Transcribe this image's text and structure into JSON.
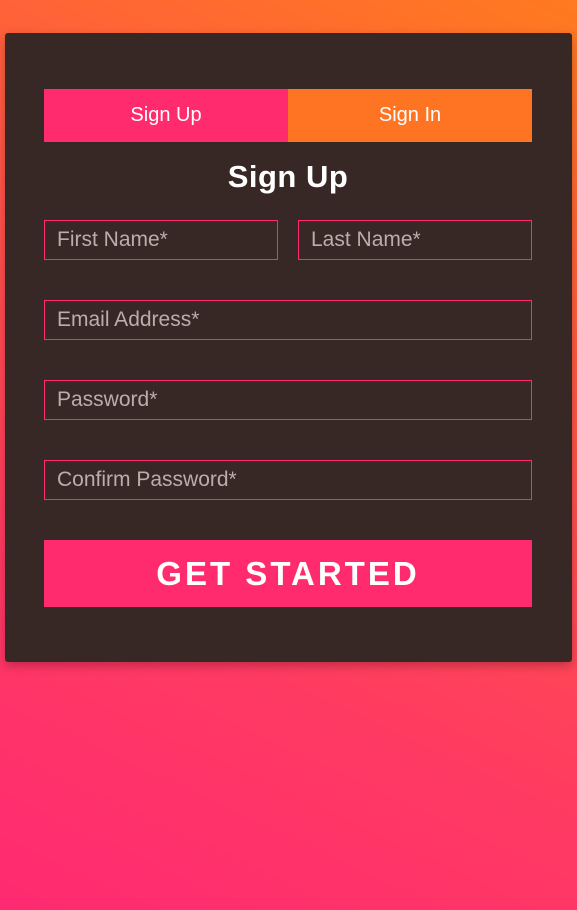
{
  "tabs": [
    {
      "label": "Sign Up",
      "active": true
    },
    {
      "label": "Sign In",
      "active": false
    }
  ],
  "form": {
    "title": "Sign Up",
    "first_name": {
      "placeholder": "First Name*",
      "value": ""
    },
    "last_name": {
      "placeholder": "Last Name*",
      "value": ""
    },
    "email": {
      "placeholder": "Email Address*",
      "value": ""
    },
    "password": {
      "placeholder": "Password*",
      "value": ""
    },
    "confirm_password": {
      "placeholder": "Confirm Password*",
      "value": ""
    },
    "submit_label": "GET STARTED"
  },
  "colors": {
    "card_background": "#372826",
    "accent_pink": "#ff2b6e",
    "accent_orange": "#ff7422",
    "background_gradient_top": "#ff7a1f",
    "background_gradient_bottom": "#ff2a72"
  }
}
